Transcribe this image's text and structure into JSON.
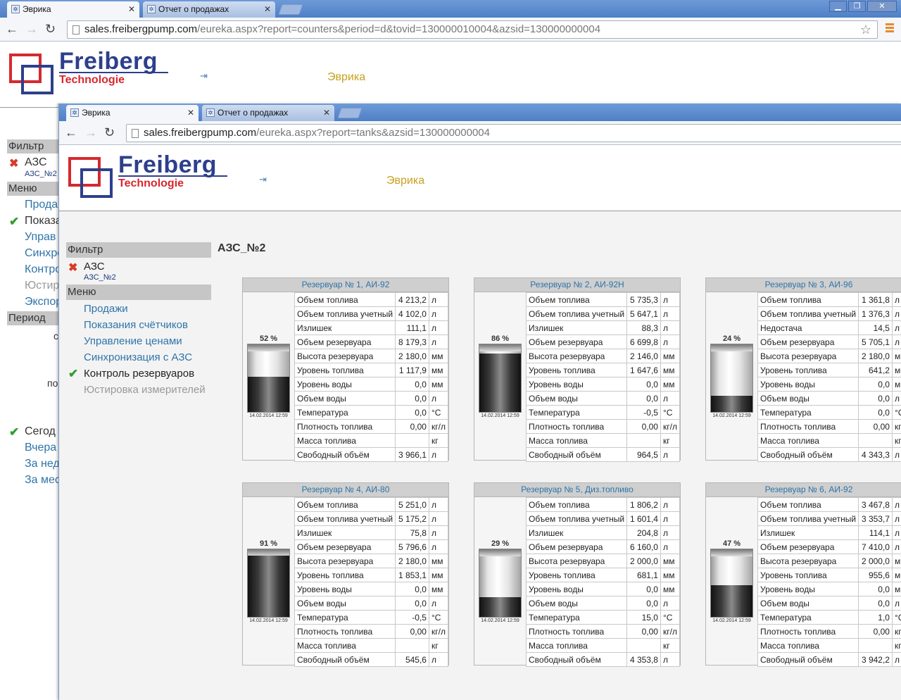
{
  "back_window": {
    "tabs": [
      {
        "label": "Эврика",
        "close": "✕"
      },
      {
        "label": "Отчет о продажах",
        "close": "✕"
      }
    ],
    "url_host": "sales.freibergpump.com",
    "url_path": "/eureka.aspx?report=counters&period=d&tovid=130000010004&azsid=130000000004",
    "logo": {
      "brand": "Freiberg",
      "sub": "Technologie"
    },
    "eureka": "Эврика",
    "sidebar": {
      "filter_header": "Фильтр",
      "filter_value": "АЗС",
      "filter_sub": "АЗС_№2",
      "menu_header": "Меню",
      "items": [
        "Прода",
        "Показа",
        "Управ",
        "Синхро",
        "Контро",
        "Юстир",
        "Экспор"
      ],
      "period_header": "Период",
      "period_frag1": "с",
      "period_frag2": "по",
      "period_items": [
        "Сегод",
        "Вчера",
        "За нед",
        "За мес"
      ]
    }
  },
  "front_window": {
    "tabs": [
      {
        "label": "Эврика",
        "close": "✕"
      },
      {
        "label": "Отчет о продажах",
        "close": "✕"
      }
    ],
    "url_host": "sales.freibergpump.com",
    "url_path": "/eureka.aspx?report=tanks&azsid=130000000004",
    "logo": {
      "brand": "Freiberg",
      "sub": "Technologie"
    },
    "eureka": "Эврика",
    "sidebar": {
      "filter_header": "Фильтр",
      "filter_value": "АЗС",
      "filter_sub": "АЗС_№2",
      "menu_header": "Меню",
      "items": [
        "Продажи",
        "Показания счётчиков",
        "Управление ценами",
        "Синхронизация с АЗС",
        "Контроль резервуаров",
        "Юстировка измерителей"
      ]
    },
    "station_title": "АЗС_№2",
    "tanks": [
      {
        "title": "Резервуар № 1, АИ-92",
        "percent_label": "52 %",
        "level": 0.52,
        "timestamp": "14.02.2014 12:59",
        "rows": [
          {
            "label": "Объем топлива",
            "value": "4 213,2",
            "unit": "л"
          },
          {
            "label": "Объем топлива учетный",
            "value": "4 102,0",
            "unit": "л"
          },
          {
            "label": "Излишек",
            "value": "111,1",
            "unit": "л"
          },
          {
            "label": "Объем резервуара",
            "value": "8 179,3",
            "unit": "л"
          },
          {
            "label": "Высота резервуара",
            "value": "2 180,0",
            "unit": "мм"
          },
          {
            "label": "Уровень топлива",
            "value": "1 117,9",
            "unit": "мм"
          },
          {
            "label": "Уровень воды",
            "value": "0,0",
            "unit": "мм"
          },
          {
            "label": "Объем воды",
            "value": "0,0",
            "unit": "л"
          },
          {
            "label": "Температура",
            "value": "0,0",
            "unit": "°С"
          },
          {
            "label": "Плотность топлива",
            "value": "0,00",
            "unit": "кг/л"
          },
          {
            "label": "Масса топлива",
            "value": "",
            "unit": "кг"
          },
          {
            "label": "Свободный объём",
            "value": "3 966,1",
            "unit": "л"
          }
        ]
      },
      {
        "title": "Резервуар № 2, АИ-92Н",
        "percent_label": "86 %",
        "level": 0.86,
        "timestamp": "14.02.2014 12:59",
        "rows": [
          {
            "label": "Объем топлива",
            "value": "5 735,3",
            "unit": "л"
          },
          {
            "label": "Объем топлива учетный",
            "value": "5 647,1",
            "unit": "л"
          },
          {
            "label": "Излишек",
            "value": "88,3",
            "unit": "л"
          },
          {
            "label": "Объем резервуара",
            "value": "6 699,8",
            "unit": "л"
          },
          {
            "label": "Высота резервуара",
            "value": "2 146,0",
            "unit": "мм"
          },
          {
            "label": "Уровень топлива",
            "value": "1 647,6",
            "unit": "мм"
          },
          {
            "label": "Уровень воды",
            "value": "0,0",
            "unit": "мм"
          },
          {
            "label": "Объем воды",
            "value": "0,0",
            "unit": "л"
          },
          {
            "label": "Температура",
            "value": "-0,5",
            "unit": "°С"
          },
          {
            "label": "Плотность топлива",
            "value": "0,00",
            "unit": "кг/л"
          },
          {
            "label": "Масса топлива",
            "value": "",
            "unit": "кг"
          },
          {
            "label": "Свободный объём",
            "value": "964,5",
            "unit": "л"
          }
        ]
      },
      {
        "title": "Резервуар № 3, АИ-96",
        "percent_label": "24 %",
        "level": 0.24,
        "timestamp": "14.02.2014 12:59",
        "rows": [
          {
            "label": "Объем топлива",
            "value": "1 361,8",
            "unit": "л"
          },
          {
            "label": "Объем топлива учетный",
            "value": "1 376,3",
            "unit": "л"
          },
          {
            "label": "Недостача",
            "value": "14,5",
            "unit": "л"
          },
          {
            "label": "Объем резервуара",
            "value": "5 705,1",
            "unit": "л"
          },
          {
            "label": "Высота резервуара",
            "value": "2 180,0",
            "unit": "мм"
          },
          {
            "label": "Уровень топлива",
            "value": "641,2",
            "unit": "мм"
          },
          {
            "label": "Уровень воды",
            "value": "0,0",
            "unit": "мм"
          },
          {
            "label": "Объем воды",
            "value": "0,0",
            "unit": "л"
          },
          {
            "label": "Температура",
            "value": "0,0",
            "unit": "°С"
          },
          {
            "label": "Плотность топлива",
            "value": "0,00",
            "unit": "кг/л"
          },
          {
            "label": "Масса топлива",
            "value": "",
            "unit": "кг"
          },
          {
            "label": "Свободный объём",
            "value": "4 343,3",
            "unit": "л"
          }
        ]
      },
      {
        "title": "Резервуар № 4, АИ-80",
        "percent_label": "91 %",
        "level": 0.91,
        "timestamp": "14.02.2014 12:59",
        "rows": [
          {
            "label": "Объем топлива",
            "value": "5 251,0",
            "unit": "л"
          },
          {
            "label": "Объем топлива учетный",
            "value": "5 175,2",
            "unit": "л"
          },
          {
            "label": "Излишек",
            "value": "75,8",
            "unit": "л"
          },
          {
            "label": "Объем резервуара",
            "value": "5 796,6",
            "unit": "л"
          },
          {
            "label": "Высота резервуара",
            "value": "2 180,0",
            "unit": "мм"
          },
          {
            "label": "Уровень топлива",
            "value": "1 853,1",
            "unit": "мм"
          },
          {
            "label": "Уровень воды",
            "value": "0,0",
            "unit": "мм"
          },
          {
            "label": "Объем воды",
            "value": "0,0",
            "unit": "л"
          },
          {
            "label": "Температура",
            "value": "-0,5",
            "unit": "°С"
          },
          {
            "label": "Плотность топлива",
            "value": "0,00",
            "unit": "кг/л"
          },
          {
            "label": "Масса топлива",
            "value": "",
            "unit": "кг"
          },
          {
            "label": "Свободный объём",
            "value": "545,6",
            "unit": "л"
          }
        ]
      },
      {
        "title": "Резервуар № 5, Диз.топливо",
        "percent_label": "29 %",
        "level": 0.29,
        "timestamp": "14.02.2014 12:59",
        "rows": [
          {
            "label": "Объем топлива",
            "value": "1 806,2",
            "unit": "л"
          },
          {
            "label": "Объем топлива учетный",
            "value": "1 601,4",
            "unit": "л"
          },
          {
            "label": "Излишек",
            "value": "204,8",
            "unit": "л"
          },
          {
            "label": "Объем резервуара",
            "value": "6 160,0",
            "unit": "л"
          },
          {
            "label": "Высота резервуара",
            "value": "2 000,0",
            "unit": "мм"
          },
          {
            "label": "Уровень топлива",
            "value": "681,1",
            "unit": "мм"
          },
          {
            "label": "Уровень воды",
            "value": "0,0",
            "unit": "мм"
          },
          {
            "label": "Объем воды",
            "value": "0,0",
            "unit": "л"
          },
          {
            "label": "Температура",
            "value": "15,0",
            "unit": "°С"
          },
          {
            "label": "Плотность топлива",
            "value": "0,00",
            "unit": "кг/л"
          },
          {
            "label": "Масса топлива",
            "value": "",
            "unit": "кг"
          },
          {
            "label": "Свободный объём",
            "value": "4 353,8",
            "unit": "л"
          }
        ]
      },
      {
        "title": "Резервуар № 6, АИ-92",
        "percent_label": "47 %",
        "level": 0.47,
        "timestamp": "14.02.2014 12:59",
        "rows": [
          {
            "label": "Объем топлива",
            "value": "3 467,8",
            "unit": "л"
          },
          {
            "label": "Объем топлива учетный",
            "value": "3 353,7",
            "unit": "л"
          },
          {
            "label": "Излишек",
            "value": "114,1",
            "unit": "л"
          },
          {
            "label": "Объем резервуара",
            "value": "7 410,0",
            "unit": "л"
          },
          {
            "label": "Высота резервуара",
            "value": "2 000,0",
            "unit": "мм"
          },
          {
            "label": "Уровень топлива",
            "value": "955,6",
            "unit": "мм"
          },
          {
            "label": "Уровень воды",
            "value": "0,0",
            "unit": "мм"
          },
          {
            "label": "Объем воды",
            "value": "0,0",
            "unit": "л"
          },
          {
            "label": "Температура",
            "value": "1,0",
            "unit": "°С"
          },
          {
            "label": "Плотность топлива",
            "value": "0,00",
            "unit": "кг/л"
          },
          {
            "label": "Масса топлива",
            "value": "",
            "unit": "кг"
          },
          {
            "label": "Свободный объём",
            "value": "3 942,2",
            "unit": "л"
          }
        ]
      }
    ]
  }
}
